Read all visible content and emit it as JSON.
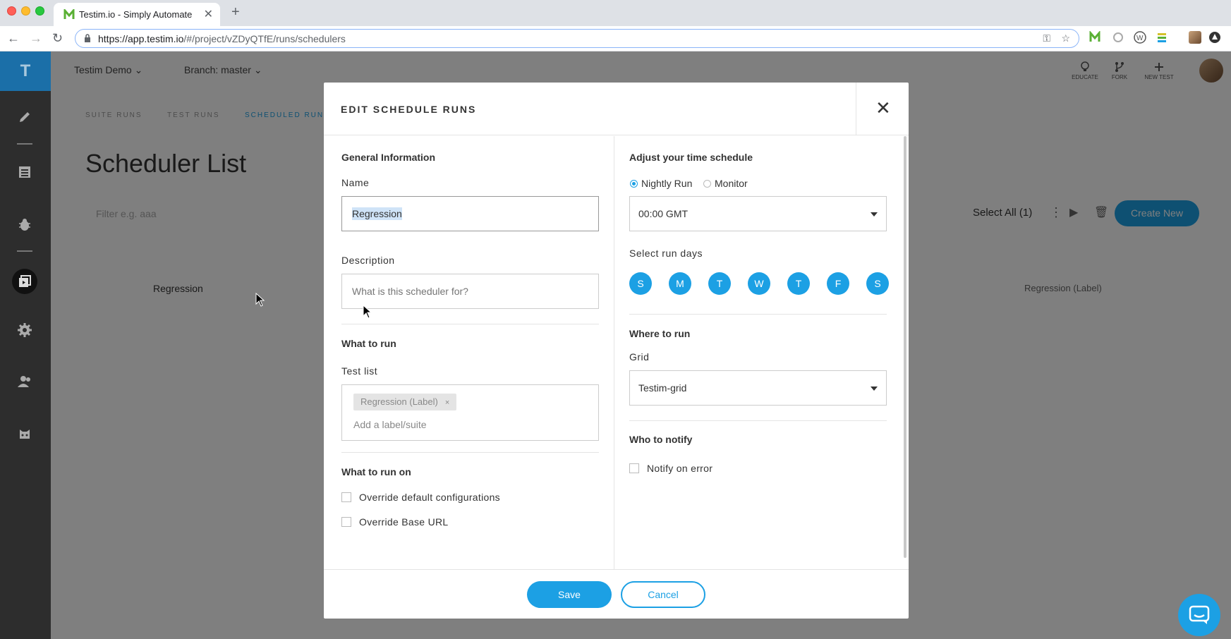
{
  "browser": {
    "tab_title": "Testim.io - Simply Automate",
    "new_tab": "+",
    "tab_close": "✕",
    "url_host": "https://app.testim.io",
    "url_path": "/#/project/vZDyQTfE/runs/schedulers"
  },
  "app": {
    "logo": "T",
    "project_selector": "Testim Demo",
    "branch_selector": "Branch: master",
    "top_actions": [
      {
        "label": "EDUCATE",
        "icon": "lightbulb-icon"
      },
      {
        "label": "FORK",
        "icon": "fork-icon"
      },
      {
        "label": "NEW TEST",
        "icon": "plus-icon"
      }
    ],
    "subtabs": [
      "SUITE RUNS",
      "TEST RUNS",
      "SCHEDULED RUNS"
    ],
    "page_title": "Scheduler List",
    "filter_placeholder": "Filter e.g. aaa",
    "select_all": "Select All (1)",
    "create_new": "Create New",
    "scheduler_row": {
      "name": "Regression",
      "label": "Regression (Label)"
    }
  },
  "modal": {
    "title": "EDIT SCHEDULE RUNS",
    "close": "✕",
    "general": {
      "section": "General Information",
      "name_label": "Name",
      "name_value": "Regression",
      "description_label": "Description",
      "description_placeholder": "What is this scheduler for?"
    },
    "what_to_run": {
      "section": "What to run",
      "test_list_label": "Test list",
      "chip": "Regression (Label)",
      "chip_remove": "×",
      "add_placeholder": "Add a label/suite"
    },
    "what_to_run_on": {
      "section": "What to run on",
      "override_config": "Override default configurations",
      "override_url": "Override Base URL"
    },
    "schedule": {
      "section": "Adjust your time schedule",
      "nightly": "Nightly Run",
      "monitor": "Monitor",
      "time_value": "00:00 GMT",
      "run_days_label": "Select run days",
      "days": [
        "S",
        "M",
        "T",
        "W",
        "T",
        "F",
        "S"
      ]
    },
    "where": {
      "section": "Where to run",
      "grid_label": "Grid",
      "grid_value": "Testim-grid"
    },
    "notify": {
      "section": "Who to notify",
      "notify_on_error": "Notify on error"
    },
    "save": "Save",
    "cancel": "Cancel"
  },
  "colors": {
    "accent": "#1ca0e4",
    "sidebar": "#2d2d2d",
    "logo_bg": "#1b6fa8"
  }
}
